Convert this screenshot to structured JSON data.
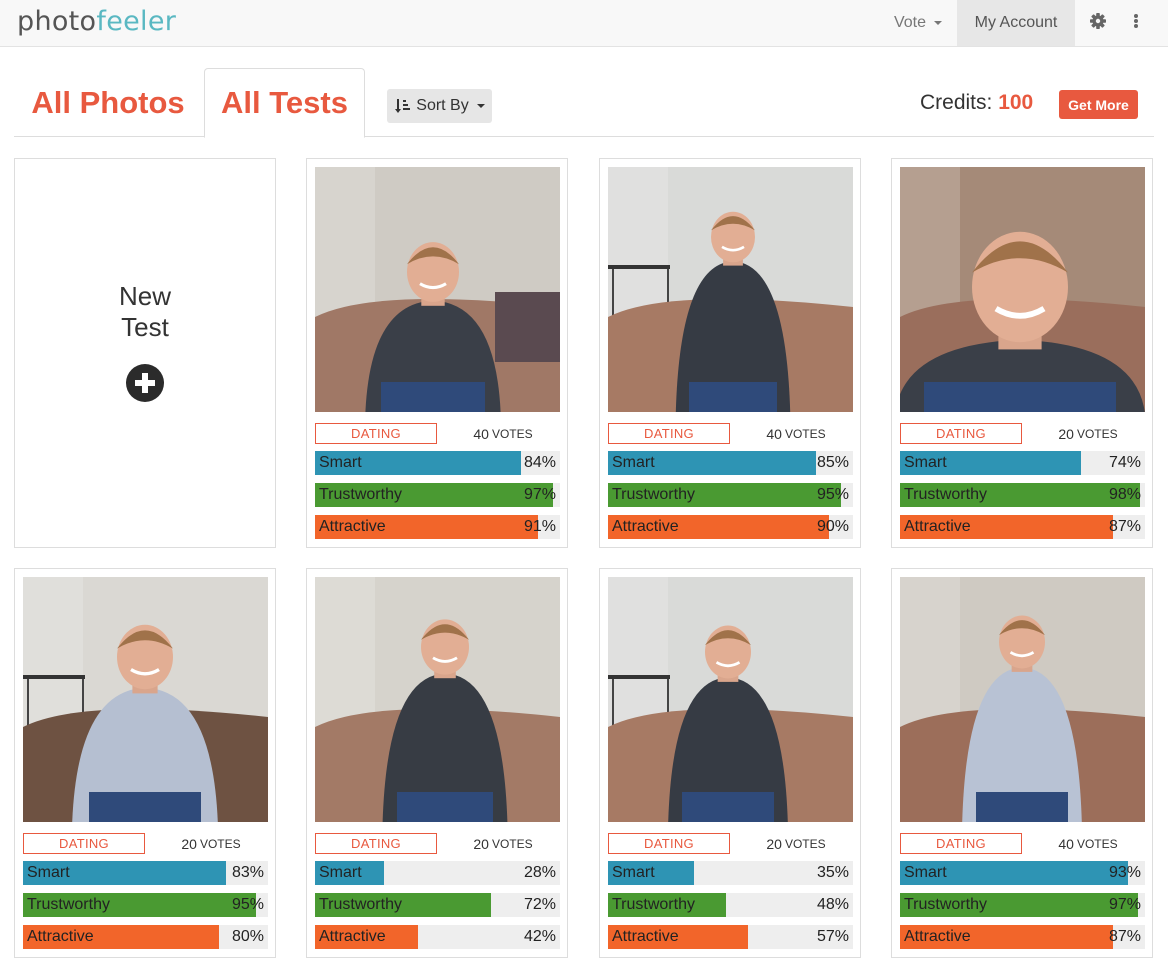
{
  "nav": {
    "logo_a": "photo",
    "logo_b": "feeler",
    "vote": "Vote",
    "account": "My Account"
  },
  "tabs": {
    "photos": "All Photos",
    "tests": "All Tests"
  },
  "sort": "Sort By",
  "credits": {
    "label": "Credits:",
    "value": "100",
    "button": "Get More"
  },
  "new_test": {
    "line1": "New",
    "line2": "Test"
  },
  "colors": {
    "accent": "#e8593f",
    "smart": "#2e94b4",
    "trustworthy": "#4a9a32",
    "attractive": "#f2652a",
    "logo": "#5ab8c2"
  },
  "traits": [
    "Smart",
    "Trustworthy",
    "Attractive"
  ],
  "votes_label": "VOTES",
  "tests": [
    {
      "category": "DATING",
      "votes": "40",
      "smart": 84,
      "trustworthy": 97,
      "attractive": 91
    },
    {
      "category": "DATING",
      "votes": "40",
      "smart": 85,
      "trustworthy": 95,
      "attractive": 90
    },
    {
      "category": "DATING",
      "votes": "20",
      "smart": 74,
      "trustworthy": 98,
      "attractive": 87
    },
    {
      "category": "DATING",
      "votes": "20",
      "smart": 83,
      "trustworthy": 95,
      "attractive": 80
    },
    {
      "category": "DATING",
      "votes": "20",
      "smart": 28,
      "trustworthy": 72,
      "attractive": 42
    },
    {
      "category": "DATING",
      "votes": "20",
      "smart": 35,
      "trustworthy": 48,
      "attractive": 57
    },
    {
      "category": "DATING",
      "votes": "40",
      "smart": 93,
      "trustworthy": 97,
      "attractive": 87
    }
  ]
}
